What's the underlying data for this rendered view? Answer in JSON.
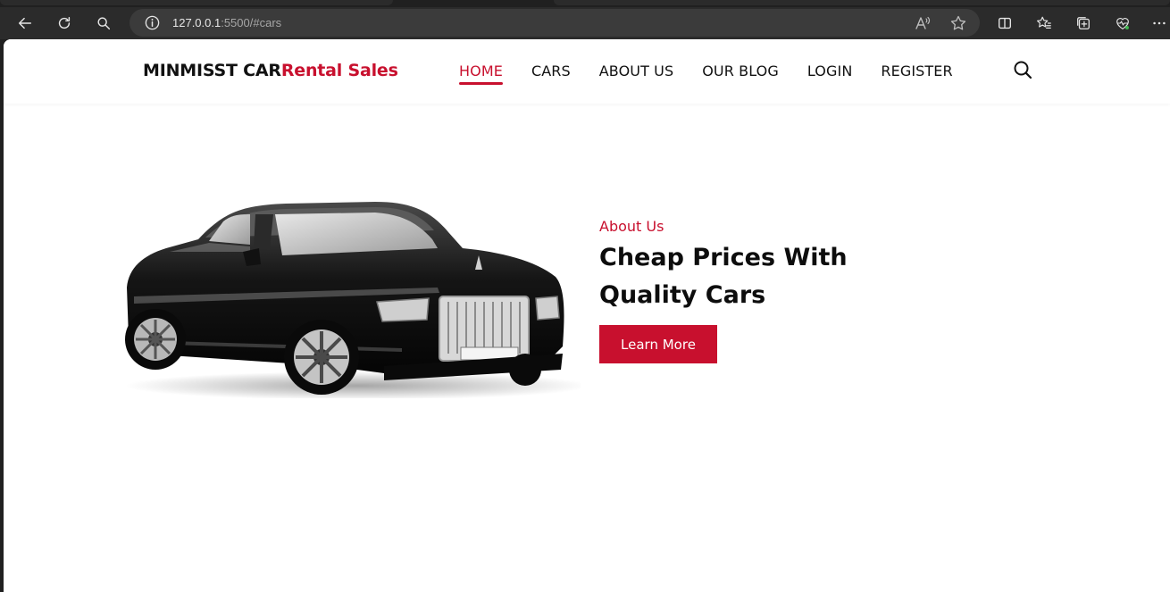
{
  "browser": {
    "url_host": "127.0.0.1",
    "url_rest": ":5500/#cars",
    "icons": [
      "back-icon",
      "refresh-icon",
      "search-icon",
      "info-icon",
      "read-aloud-icon",
      "favorite-star-icon",
      "split-screen-icon",
      "favorites-icon",
      "collections-icon",
      "performance-icon",
      "more-icon"
    ]
  },
  "navbar": {
    "brand_primary": "MINMISST CAR",
    "brand_accent": "Rental Sales",
    "items": [
      {
        "label": "HOME",
        "active": true
      },
      {
        "label": "CARS",
        "active": false
      },
      {
        "label": "ABOUT US",
        "active": false
      },
      {
        "label": "OUR BLOG",
        "active": false
      },
      {
        "label": "LOGIN",
        "active": false
      },
      {
        "label": "REGISTER",
        "active": false
      }
    ]
  },
  "hero": {
    "eyebrow": "About Us",
    "headline": "Cheap Prices With Quality Cars",
    "cta_label": "Learn More",
    "image": "black-luxury-sedan"
  },
  "colors": {
    "accent": "#c8102e",
    "text": "#111111",
    "chrome_bg": "#2b2b2b"
  }
}
